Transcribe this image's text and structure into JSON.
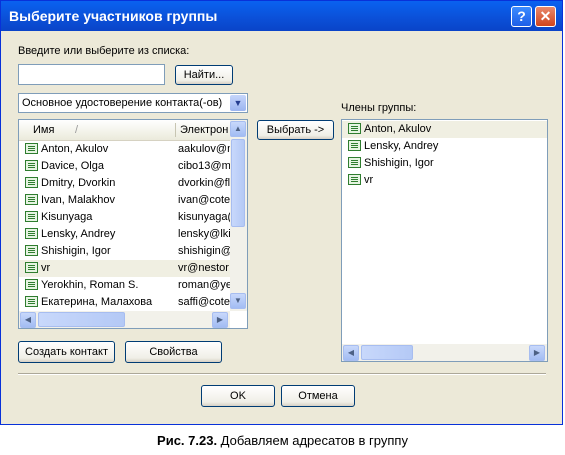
{
  "dialog": {
    "title": "Выберите участников группы",
    "help_label": "?",
    "close_label": "✕"
  },
  "search": {
    "prompt": "Введите или выберите из списка:",
    "value": "",
    "find_label": "Найти..."
  },
  "address_book": {
    "selected": "Основное удостоверение контакта(-ов)"
  },
  "contacts": {
    "columns": [
      "Имя",
      "Электрон"
    ],
    "sort_indicator": "/",
    "rows": [
      {
        "name": "Anton, Akulov",
        "email": "aakulov@n"
      },
      {
        "name": "Davice, Olga",
        "email": "cibo13@m"
      },
      {
        "name": "Dmitry, Dvorkin",
        "email": "dvorkin@fl"
      },
      {
        "name": "Ivan, Malakhov",
        "email": "ivan@cote"
      },
      {
        "name": "Kisunyaga",
        "email": "kisunyaga("
      },
      {
        "name": "Lensky, Andrey",
        "email": "lensky@lki"
      },
      {
        "name": "Shishigin, Igor",
        "email": "shishigin@"
      },
      {
        "name": "vr",
        "email": "vr@nestor"
      },
      {
        "name": "Yerokhin, Roman S.",
        "email": "roman@ye"
      },
      {
        "name": "Екатерина, Малахова",
        "email": "saffi@cote"
      }
    ],
    "selected_index": 7
  },
  "select_button_label": "Выбрать ->",
  "members": {
    "label": "Члены группы:",
    "items": [
      "Anton, Akulov",
      "Lensky, Andrey",
      "Shishigin, Igor",
      "vr"
    ],
    "selected_index": 0
  },
  "buttons": {
    "create_contact": "Создать контакт",
    "properties": "Свойства",
    "ok": "OK",
    "cancel": "Отмена"
  },
  "caption": {
    "number": "Рис. 7.23.",
    "text": " Добавляем адресатов в группу"
  },
  "colors": {
    "titlebar": "#0b4fd7",
    "dialog_bg": "#ece9d8"
  },
  "icons": {
    "contact": "contact-card-icon",
    "scroll_up": "scroll-up-arrow-icon",
    "scroll_down": "scroll-down-arrow-icon",
    "scroll_left": "scroll-left-arrow-icon",
    "scroll_right": "scroll-right-arrow-icon",
    "dropdown": "chevron-down-icon"
  }
}
